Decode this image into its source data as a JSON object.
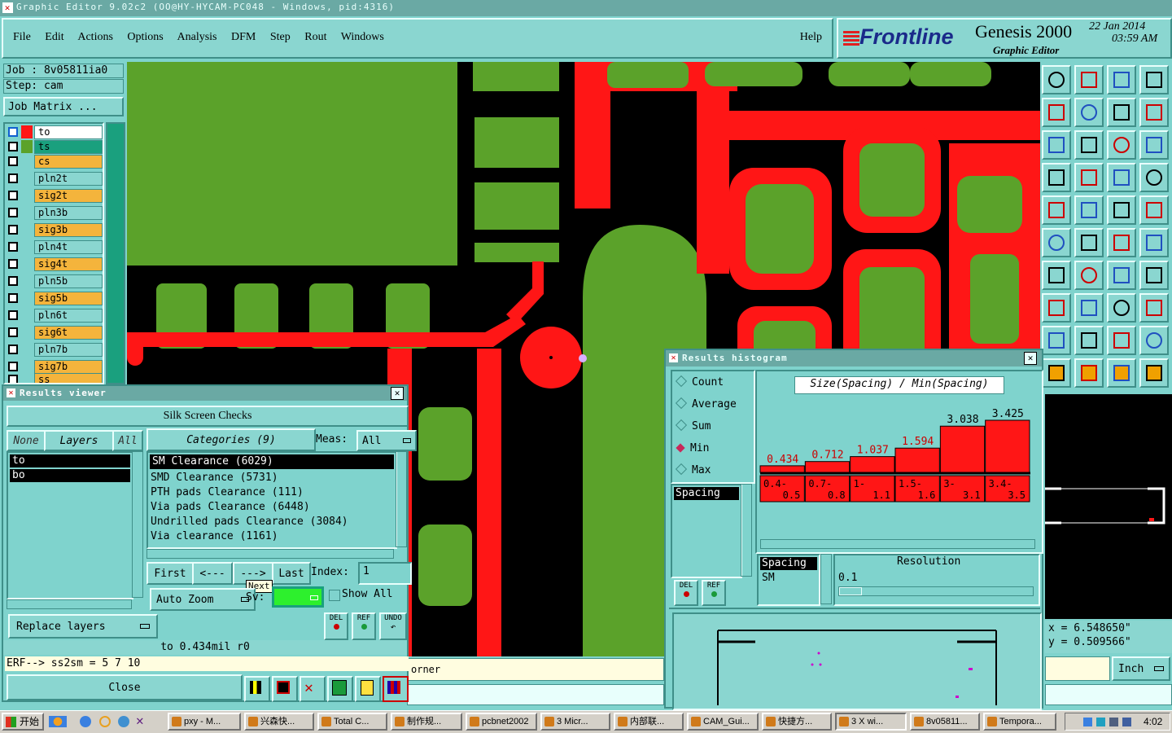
{
  "window": {
    "title": "Graphic Editor 9.02c2 (OO@HY-HYCAM-PC048 - Windows, pid:4316)"
  },
  "menu": {
    "items": [
      "File",
      "Edit",
      "Actions",
      "Options",
      "Analysis",
      "DFM",
      "Step",
      "Rout",
      "Windows"
    ],
    "help": "Help"
  },
  "brand": {
    "logo": "Frontline",
    "product": "Genesis 2000",
    "subtitle": "Graphic Editor",
    "date": "22 Jan 2014",
    "time": "03:59 AM"
  },
  "job": {
    "job_label": "Job : 8v05811ia0",
    "step_label": "Step: cam",
    "matrix_button": "Job Matrix ..."
  },
  "layers": [
    "to",
    "ts",
    "cs",
    "pln2t",
    "sig2t",
    "pln3b",
    "sig3b",
    "pln4t",
    "sig4t",
    "pln5b",
    "sig5b",
    "pln6t",
    "sig6t",
    "pln7b",
    "sig7b",
    "ss"
  ],
  "results_viewer": {
    "title": "Results viewer",
    "header": "Silk Screen Checks",
    "none_btn": "None",
    "layers_btn": "Layers",
    "all_btn": "All",
    "layer_list": [
      "to",
      "bo"
    ],
    "categories_btn": "Categories (9)",
    "meas_label": "Meas:",
    "meas_value": "All",
    "categories": [
      "SM Clearance (6029)",
      "SMD Clearance (5731)",
      "PTH pads Clearance (111)",
      "Via pads Clearance (6448)",
      "Undrilled pads Clearance (3084)",
      "Via clearance (1161)"
    ],
    "first": "First",
    "prev": "<---",
    "next": "--->",
    "last": "Last",
    "index_label": "Index:",
    "index_value": "1",
    "tooltip": "Next",
    "auto_zoom": "Auto Zoom",
    "sv_label": "Sv:",
    "show_all": "Show All",
    "replace_layers": "Replace layers",
    "del": "DEL",
    "ref": "REF",
    "undo": "UNDO",
    "status": "to 0.434mil  r0",
    "erf": "ERF--> ss2sm = 5 7 10",
    "close": "Close"
  },
  "histogram": {
    "title": "Results histogram",
    "options": [
      "Count",
      "Average",
      "Sum",
      "Min",
      "Max"
    ],
    "selected": "Min",
    "metric_list": [
      "Spacing"
    ],
    "chart_title": "Size(Spacing) / Min(Spacing)",
    "del": "DEL",
    "ref": "REF",
    "list2": [
      "Spacing",
      "SM"
    ],
    "resolution_label": "Resolution",
    "resolution_value": "0.1"
  },
  "chart_data": {
    "type": "bar",
    "title": "Size(Spacing) / Min(Spacing)",
    "categories": [
      "0.4-0.5",
      "0.7-0.8",
      "1-1.1",
      "1.5-1.6",
      "3-3.1",
      "3.4-3.5"
    ],
    "values": [
      0.434,
      0.712,
      1.037,
      1.594,
      3.038,
      3.425
    ],
    "bar_labels": [
      "0.434",
      "0.712",
      "1.037",
      "1.594",
      "3.038",
      "3.425"
    ],
    "cat_top": [
      "0.4-",
      "0.7-",
      "1-",
      "1.5-",
      "3-",
      "3.4-"
    ],
    "cat_bottom": [
      "0.5",
      "0.8",
      "1.1",
      "1.6",
      "3.1",
      "3.5"
    ]
  },
  "coords": {
    "x": "x = 6.548650\"",
    "y": "y = 0.509566\"",
    "unit": "Inch"
  },
  "canvas_fragment": "orner",
  "taskbar": {
    "start": "开始",
    "items": [
      "pxy - M...",
      "兴森快...",
      "Total C...",
      "制作规...",
      "pcbnet2002",
      "3 Micr...",
      "内部联...",
      "CAM_Gui...",
      "快捷方...",
      "3 X wi...",
      "8v05811...",
      "Tempora..."
    ],
    "clock": "4:02"
  }
}
